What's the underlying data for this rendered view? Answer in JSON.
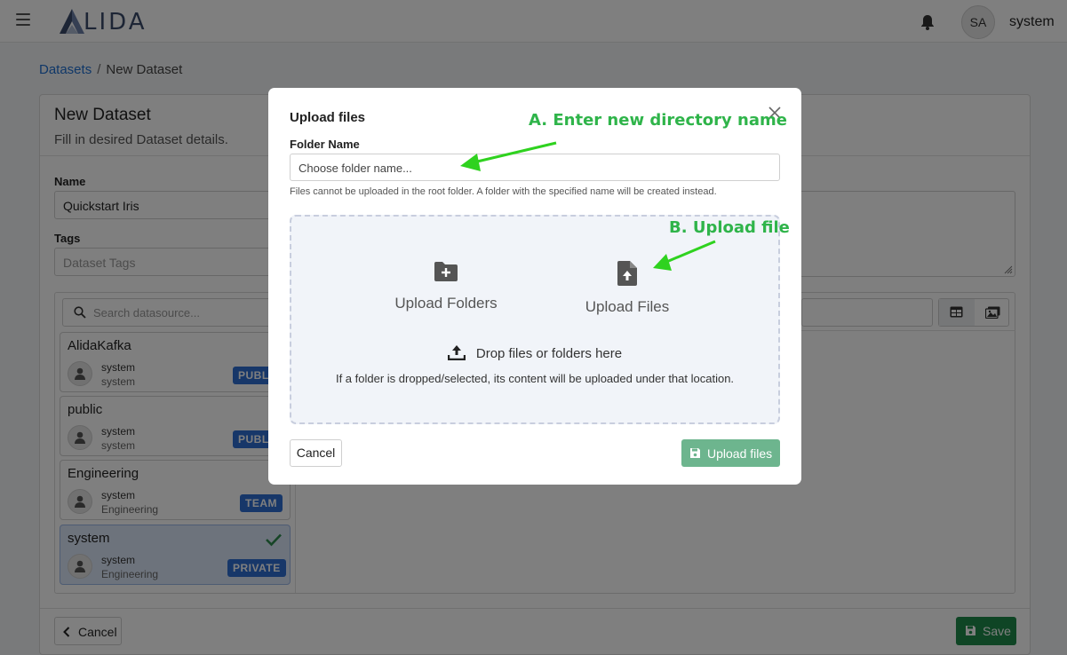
{
  "app": {
    "logo_text": "LIDA",
    "user_initials": "SA",
    "user_name": "system"
  },
  "breadcrumb": {
    "root": "Datasets",
    "separator": "/",
    "current": "New Dataset"
  },
  "form": {
    "title": "New Dataset",
    "subtitle": "Fill in desired Dataset details.",
    "name_label": "Name",
    "name_value": "Quickstart Iris",
    "tags_label": "Tags",
    "tags_placeholder": "Dataset Tags",
    "search_placeholder": "Search datasource...",
    "cancel_label": "Cancel",
    "save_label": "Save"
  },
  "datasources": [
    {
      "name": "AlidaKafka",
      "owner": "system",
      "group": "system",
      "badge": "PUBLIC",
      "selected": false
    },
    {
      "name": "public",
      "owner": "system",
      "group": "system",
      "badge": "PUBLIC",
      "selected": false
    },
    {
      "name": "Engineering",
      "owner": "system",
      "group": "Engineering",
      "badge": "TEAM",
      "selected": false
    },
    {
      "name": "system",
      "owner": "system",
      "group": "Engineering",
      "badge": "PRIVATE",
      "selected": true
    }
  ],
  "modal": {
    "title": "Upload files",
    "folder_label": "Folder Name",
    "folder_placeholder": "Choose folder name...",
    "folder_hint": "Files cannot be uploaded in the root folder. A folder with the specified name will be created instead.",
    "upload_folders_label": "Upload Folders",
    "upload_files_label": "Upload Files",
    "drop_label": "Drop files or folders here",
    "drop_hint": "If a folder is dropped/selected, its content will be uploaded under that location.",
    "cancel_label": "Cancel",
    "upload_label": "Upload files"
  },
  "annotations": {
    "a": "A. Enter new directory name",
    "b": "B. Upload file"
  },
  "colors": {
    "accent_blue": "#1f6fd1",
    "badge_blue": "#2f6fd2",
    "save_green": "#1e8a4a",
    "upload_green": "#6db58e",
    "annotation_green": "#2fb44a"
  }
}
